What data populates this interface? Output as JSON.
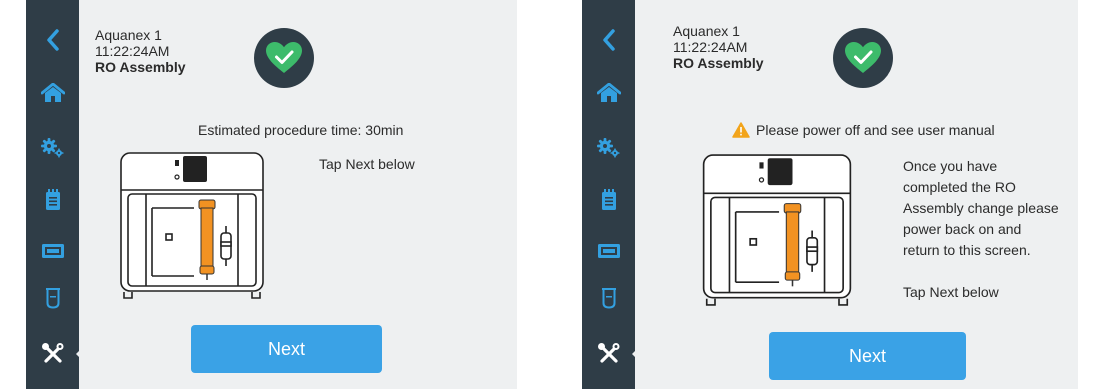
{
  "screens": [
    {
      "header": {
        "device_name": "Aquanex 1",
        "time": "11:22:24AM",
        "location": "RO Assembly"
      },
      "status": "ok",
      "message": "Estimated procedure time: 30min",
      "instructions": [
        "Tap Next below"
      ],
      "next_label": "Next"
    },
    {
      "header": {
        "device_name": "Aquanex 1",
        "time": "11:22:24AM",
        "location": "RO Assembly"
      },
      "status": "ok",
      "warning": "Please power off and see user manual",
      "instructions": [
        "Once you have",
        "completed the RO",
        "Assembly change please",
        "power back on and",
        "return to this screen.",
        "",
        "Tap Next below"
      ],
      "next_label": "Next"
    }
  ],
  "sidebar": {
    "items": [
      {
        "icon": "back-arrow-icon"
      },
      {
        "icon": "home-icon"
      },
      {
        "icon": "settings-gears-icon"
      },
      {
        "icon": "notepad-icon"
      },
      {
        "icon": "display-icon"
      },
      {
        "icon": "beaker-icon"
      },
      {
        "icon": "tools-icon",
        "active": true
      }
    ]
  },
  "colors": {
    "sidebar": "#2f3d47",
    "icon_accent": "#33a0e0",
    "accent_button": "#3aa2e6",
    "status_ok": "#3dbb6b",
    "cartridge": "#f29222",
    "warning": "#f2a41b"
  }
}
